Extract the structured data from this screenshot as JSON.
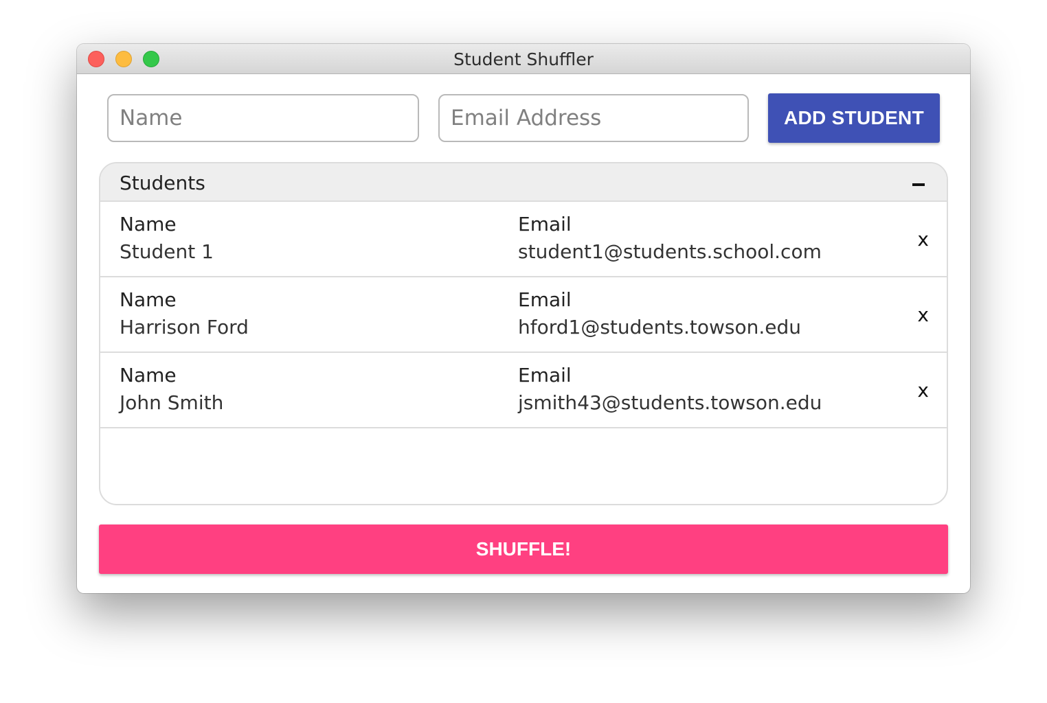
{
  "window": {
    "title": "Student Shuffler"
  },
  "form": {
    "name_placeholder": "Name",
    "name_value": "",
    "email_placeholder": "Email Address",
    "email_value": "",
    "add_label": "ADD STUDENT"
  },
  "students_panel": {
    "title": "Students",
    "collapse_icon": "minus-icon",
    "name_label": "Name",
    "email_label": "Email",
    "remove_label": "x",
    "rows": [
      {
        "name": "Student 1",
        "email": "student1@students.school.com"
      },
      {
        "name": "Harrison Ford",
        "email": "hford1@students.towson.edu"
      },
      {
        "name": "John Smith",
        "email": "jsmith43@students.towson.edu"
      }
    ]
  },
  "shuffle": {
    "label": "SHUFFLE!"
  },
  "colors": {
    "primary": "#3f51b5",
    "accent": "#ff4081",
    "traffic_close": "#fc605c",
    "traffic_minimize": "#fdbc40",
    "traffic_zoom": "#34c84a"
  }
}
